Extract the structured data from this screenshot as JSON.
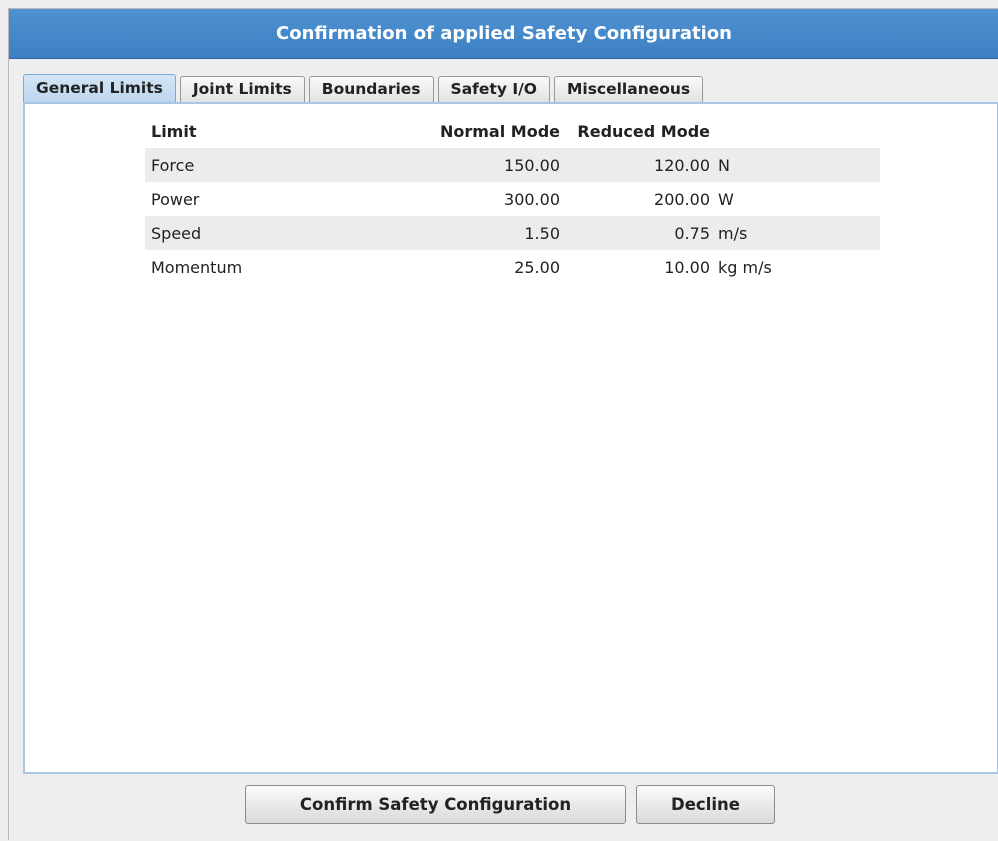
{
  "dialog": {
    "title": "Confirmation of applied Safety Configuration"
  },
  "tabs": [
    {
      "label": "General Limits",
      "active": true
    },
    {
      "label": "Joint Limits",
      "active": false
    },
    {
      "label": "Boundaries",
      "active": false
    },
    {
      "label": "Safety I/O",
      "active": false
    },
    {
      "label": "Miscellaneous",
      "active": false
    }
  ],
  "table": {
    "headers": {
      "limit": "Limit",
      "normal": "Normal Mode",
      "reduced": "Reduced Mode"
    },
    "rows": [
      {
        "limit": "Force",
        "normal": "150.00",
        "reduced": "120.00",
        "unit": "N"
      },
      {
        "limit": "Power",
        "normal": "300.00",
        "reduced": "200.00",
        "unit": "W"
      },
      {
        "limit": "Speed",
        "normal": "1.50",
        "reduced": "0.75",
        "unit": "m/s"
      },
      {
        "limit": "Momentum",
        "normal": "25.00",
        "reduced": "10.00",
        "unit": "kg m/s"
      }
    ]
  },
  "buttons": {
    "confirm": "Confirm Safety Configuration",
    "decline": "Decline"
  },
  "colors": {
    "titlebar": "#3d80c2",
    "active_tab": "#c8dff4",
    "panel_border": "#a9c6e4",
    "row_shade": "#ececec"
  }
}
